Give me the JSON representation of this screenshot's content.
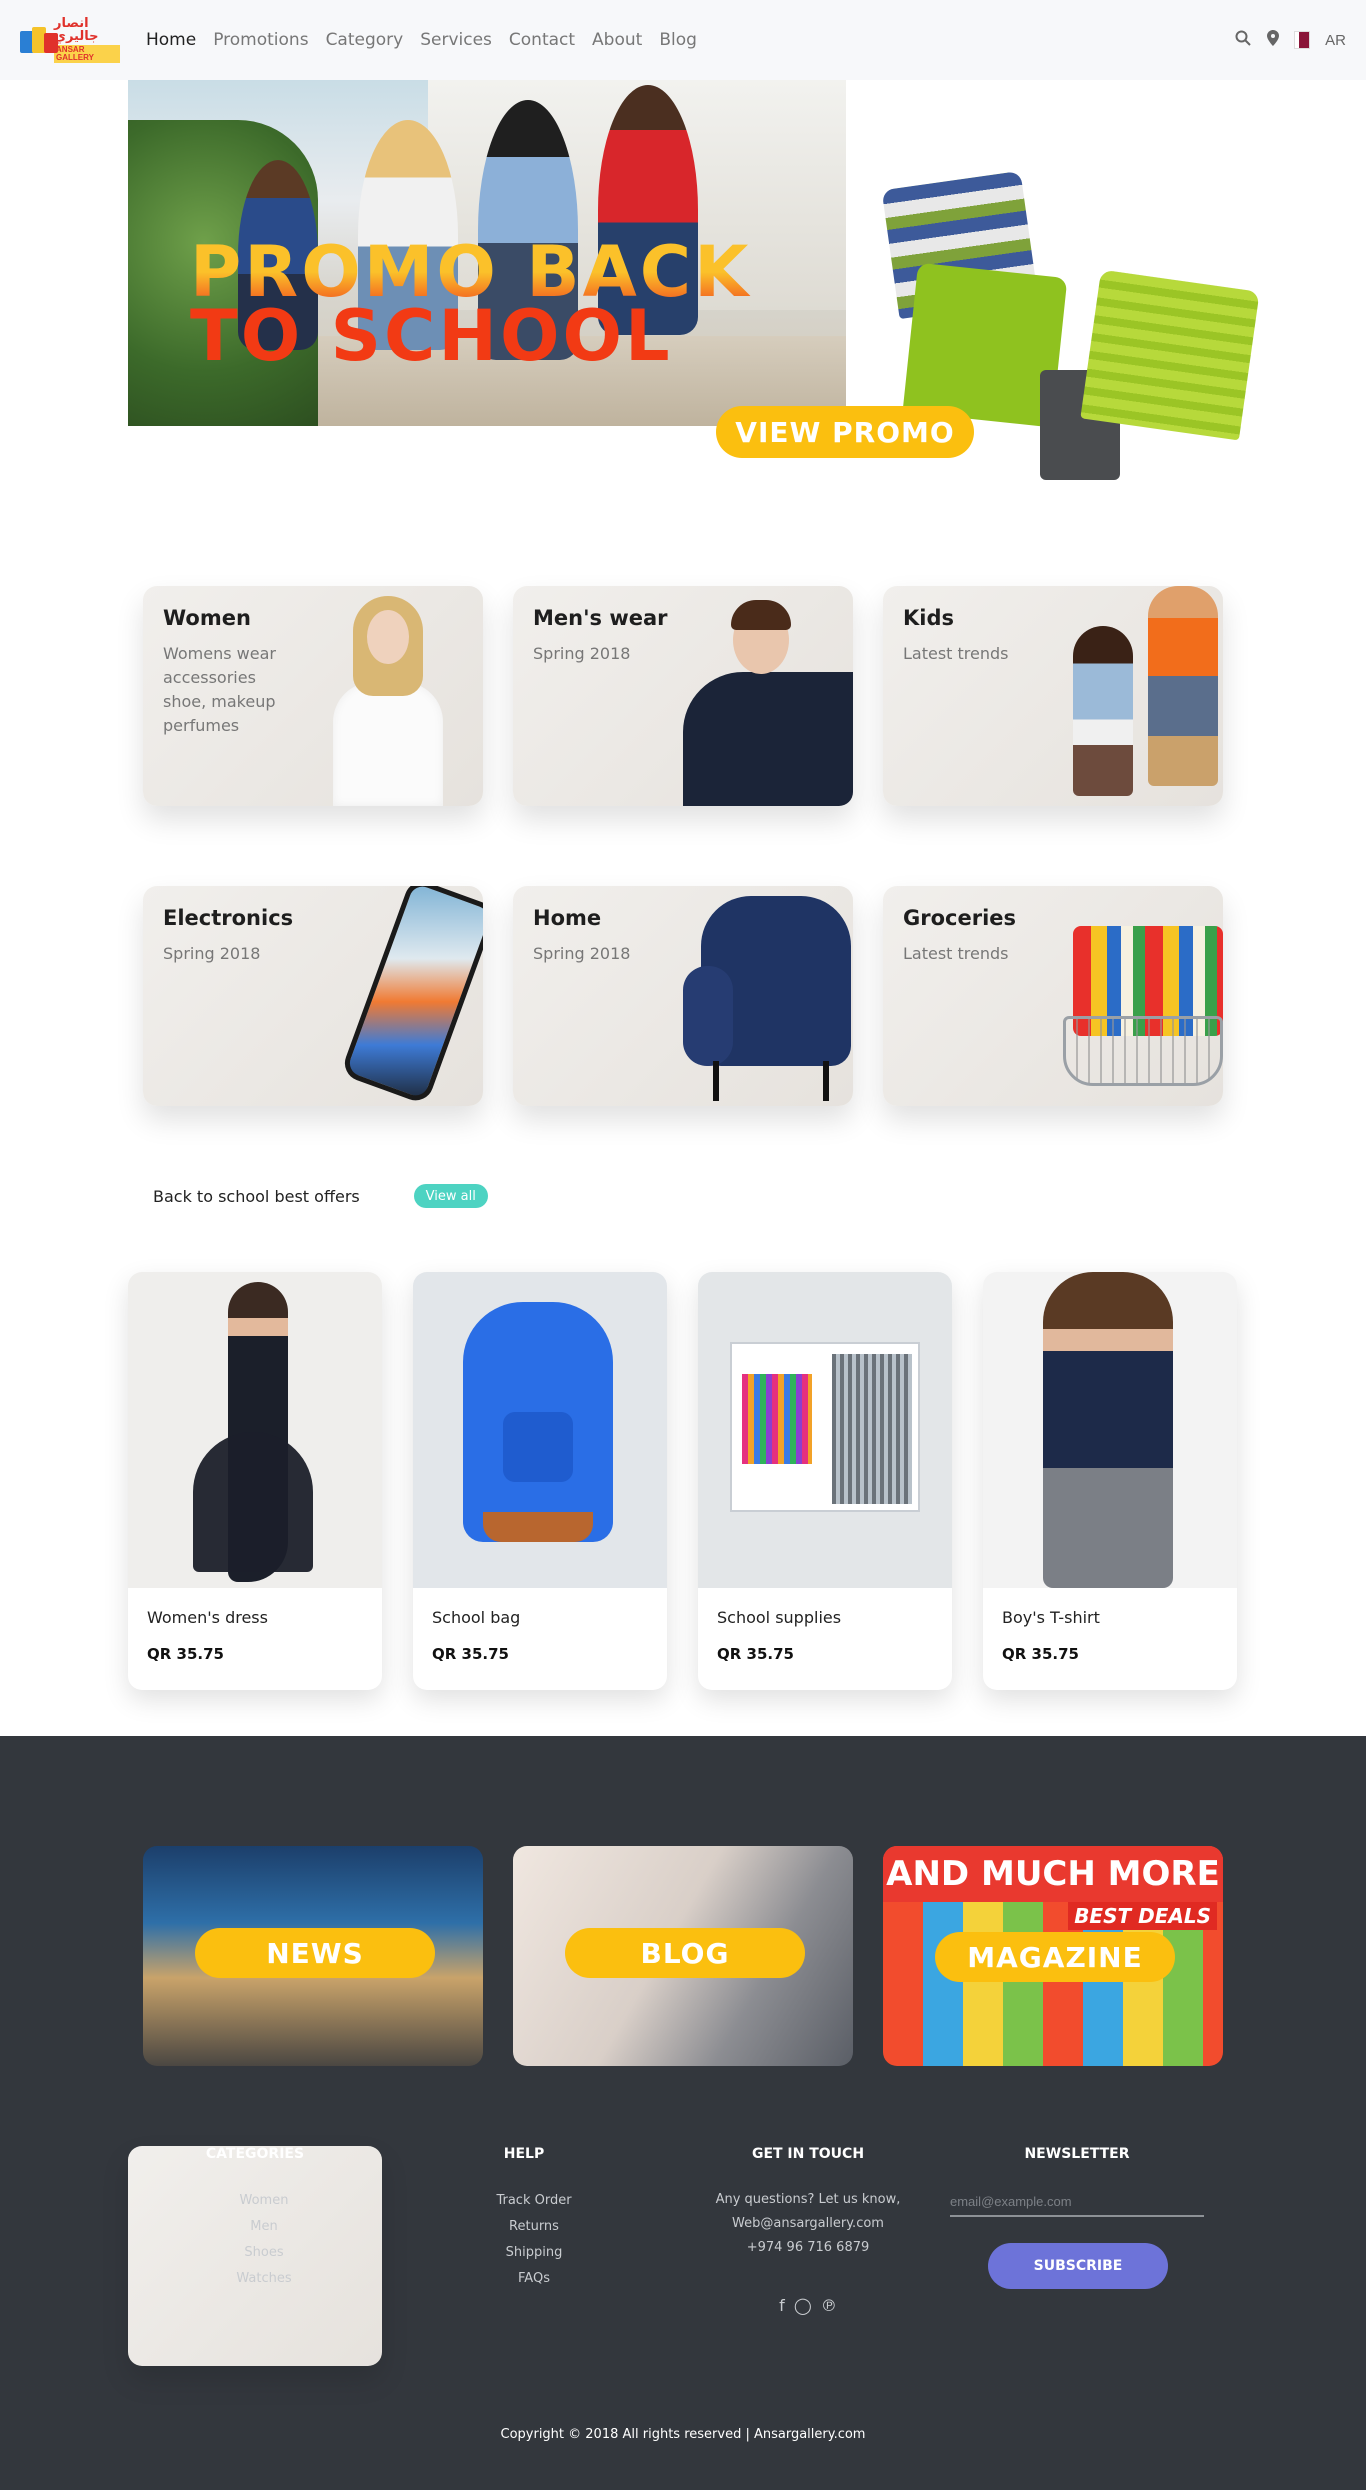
{
  "nav": {
    "logo_text_ar": "انصار جاليري",
    "logo_text_en": "ANSAR GALLERY",
    "links": [
      "Home",
      "Promotions",
      "Category",
      "Services",
      "Contact",
      "About",
      "Blog"
    ],
    "active": "Home",
    "lang": "AR"
  },
  "hero": {
    "title_line1": "PROMO BACK",
    "title_line2": "TO SCHOOL",
    "button": "VIEW PROMO"
  },
  "categories": [
    {
      "title": "Women",
      "subtitle": "Womens wear accessories shoe, makeup perfumes"
    },
    {
      "title": "Men's wear",
      "subtitle": "Spring 2018"
    },
    {
      "title": "Kids",
      "subtitle": "Latest trends"
    },
    {
      "title": "Electronics",
      "subtitle": "Spring 2018"
    },
    {
      "title": "Home",
      "subtitle": "Spring 2018"
    },
    {
      "title": "Groceries",
      "subtitle": "Latest trends"
    }
  ],
  "offers": {
    "title": "Back to school best offers",
    "view_all": "View all"
  },
  "products": [
    {
      "name": "Women's dress",
      "price": "QR 35.75"
    },
    {
      "name": "School bag",
      "price": "QR 35.75"
    },
    {
      "name": "School supplies",
      "price": "QR 35.75"
    },
    {
      "name": "Boy's T-shirt",
      "price": "QR 35.75"
    }
  ],
  "footer_tiles": {
    "news": "NEWS",
    "blog": "BLOG",
    "magazine": "MAGAZINE",
    "magazine_banner": "AND MUCH MORE",
    "deals": "BEST DEALS"
  },
  "footer": {
    "categories": {
      "title": "CATEGORIES",
      "items": [
        "Women",
        "Men",
        "Shoes",
        "Watches"
      ]
    },
    "help": {
      "title": "HELP",
      "items": [
        "Track Order",
        "Returns",
        "Shipping",
        "FAQs"
      ]
    },
    "touch": {
      "title": "GET IN TOUCH",
      "line1": "Any questions? Let us know,",
      "line2": "Web@ansargallery.com",
      "line3": "+974 96 716 6879"
    },
    "newsletter": {
      "title": "NEWSLETTER",
      "placeholder": "email@example.com",
      "button": "SUBSCRIBE"
    },
    "copyright": "Copyright © 2018 All rights reserved | Ansargallery.com"
  }
}
